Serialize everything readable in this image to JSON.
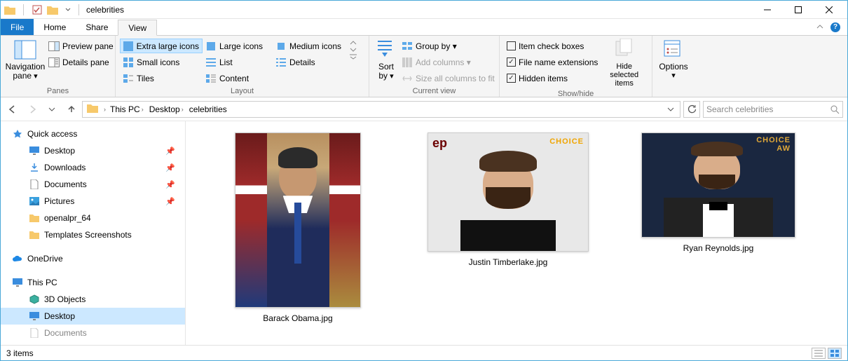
{
  "title": "celebrities",
  "tabs": {
    "file": "File",
    "home": "Home",
    "share": "Share",
    "view": "View"
  },
  "ribbon": {
    "panes": {
      "label": "Panes",
      "nav": "Navigation pane",
      "preview": "Preview pane",
      "details": "Details pane"
    },
    "layout": {
      "label": "Layout",
      "extra_large": "Extra large icons",
      "large": "Large icons",
      "medium": "Medium icons",
      "small": "Small icons",
      "list": "List",
      "details": "Details",
      "tiles": "Tiles",
      "content": "Content"
    },
    "currentview": {
      "label": "Current view",
      "sortby": "Sort by",
      "groupby": "Group by",
      "addcols": "Add columns",
      "sizecols": "Size all columns to fit"
    },
    "showhide": {
      "label": "Show/hide",
      "itemcheck": "Item check boxes",
      "ext": "File name extensions",
      "hidden": "Hidden items",
      "hidesel": "Hide selected items"
    },
    "options": "Options"
  },
  "breadcrumb": {
    "b1": "This PC",
    "b2": "Desktop",
    "b3": "celebrities"
  },
  "search": {
    "placeholder": "Search celebrities"
  },
  "sidebar": {
    "quick": "Quick access",
    "desktop": "Desktop",
    "downloads": "Downloads",
    "documents": "Documents",
    "pictures": "Pictures",
    "openalpr": "openalpr_64",
    "templates": "Templates Screenshots",
    "onedrive": "OneDrive",
    "thispc": "This PC",
    "objects3d": "3D Objects",
    "desktop2": "Desktop",
    "documents2": "Documents"
  },
  "files": {
    "f1": "Barack Obama.jpg",
    "f2": "Justin Timberlake.jpg",
    "f3": "Ryan Reynolds.jpg"
  },
  "status": {
    "items": "3 items"
  }
}
